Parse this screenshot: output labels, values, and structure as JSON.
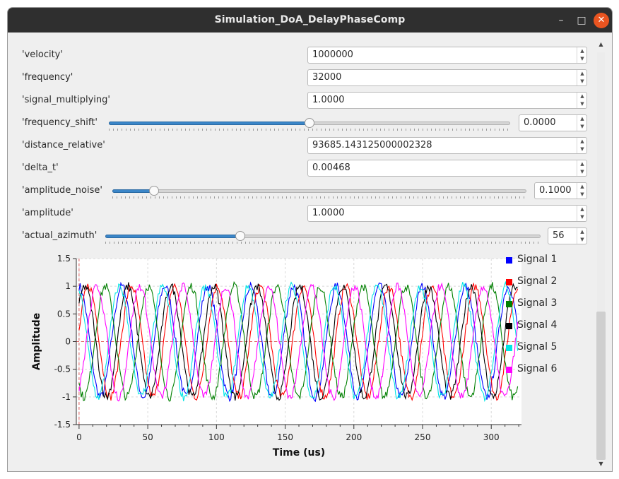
{
  "window": {
    "title": "Simulation_DoA_DelayPhaseComp",
    "minimize_glyph": "–",
    "maximize_glyph": "□",
    "close_glyph": "✕"
  },
  "params": [
    {
      "key": "velocity",
      "label": "'velocity'",
      "value": "1000000"
    },
    {
      "key": "frequency",
      "label": "'frequency'",
      "value": "32000"
    },
    {
      "key": "signal_multiplying",
      "label": "'signal_multiplying'",
      "value": "1.0000"
    },
    {
      "key": "frequency_shift",
      "label": "'frequency_shift'",
      "value": "0.0000",
      "slider_fraction": 0.5
    },
    {
      "key": "distance_relative",
      "label": "'distance_relative'",
      "value": "93685.143125000002328"
    },
    {
      "key": "delta_t",
      "label": "'delta_t'",
      "value": "0.00468"
    },
    {
      "key": "amplitude_noise",
      "label": "'amplitude_noise'",
      "value": "0.1000",
      "slider_fraction": 0.1
    },
    {
      "key": "amplitude",
      "label": "'amplitude'",
      "value": "1.0000"
    },
    {
      "key": "actual_azimuth",
      "label": "'actual_azimuth'",
      "value": "56",
      "slider_fraction": 0.31
    }
  ],
  "chart_data": {
    "type": "line",
    "xlabel": "Time (us)",
    "ylabel": "Amplitude",
    "xlim": [
      -2,
      322
    ],
    "ylim": [
      -1.5,
      1.5
    ],
    "xticks": [
      "0",
      "50",
      "100",
      "150",
      "200",
      "250",
      "300"
    ],
    "xtick_values": [
      0,
      50,
      100,
      150,
      200,
      250,
      300
    ],
    "yticks": [
      "1.5",
      "1",
      "0.5",
      "0",
      "-0.5",
      "-1",
      "-1.5"
    ],
    "ytick_values": [
      1.5,
      1,
      0.5,
      0,
      -0.5,
      -1,
      -1.5
    ],
    "grid": true,
    "legend_position": "right",
    "frequency_khz": 32,
    "noise_amplitude": 0.1,
    "series": [
      {
        "name": "Signal 1",
        "color": "#0000ff",
        "phase_deg": 90
      },
      {
        "name": "Signal 2",
        "color": "#ff0000",
        "phase_deg": 10
      },
      {
        "name": "Signal 3",
        "color": "#008000",
        "phase_deg": 230
      },
      {
        "name": "Signal 4",
        "color": "#000000",
        "phase_deg": 40
      },
      {
        "name": "Signal 5",
        "color": "#00e5e5",
        "phase_deg": 110
      },
      {
        "name": "Signal 6",
        "color": "#ff00ff",
        "phase_deg": 300
      }
    ]
  }
}
